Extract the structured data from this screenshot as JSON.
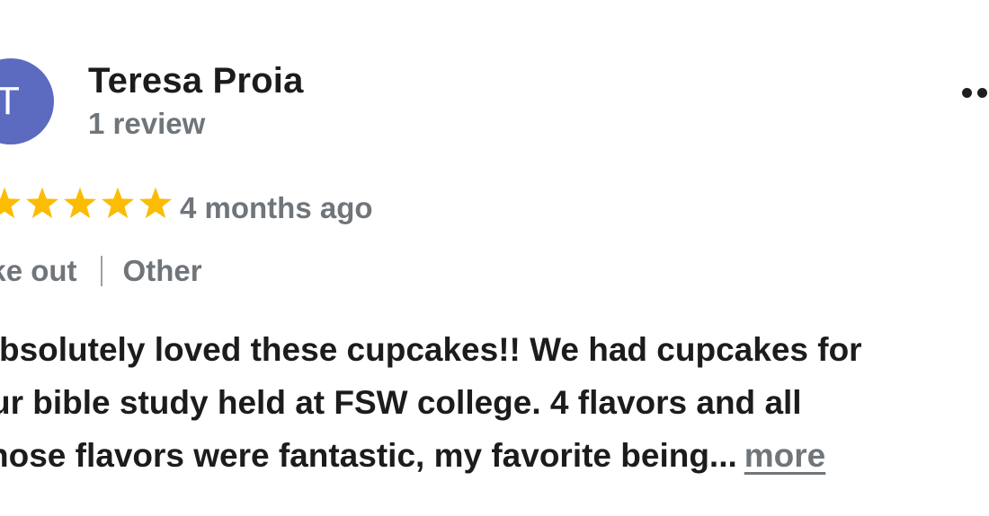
{
  "review": {
    "avatar_initial": "T",
    "avatar_color": "#5c6bc0",
    "reviewer_name": "Teresa Proia",
    "review_count": "1 review",
    "rating": 5,
    "rating_max": 5,
    "star_color": "#fbbc04",
    "date": "4 months ago",
    "tags": [
      "ake out",
      "Other"
    ],
    "text_lines": [
      "bsolutely loved these cupcakes!! We had cupcakes for",
      "ur bible study held at FSW college. 4 flavors and all",
      "hose flavors were fantastic, my favorite being..."
    ],
    "more_label": "more"
  },
  "icons": {
    "menu": "more-options-icon",
    "star": "star-icon"
  }
}
